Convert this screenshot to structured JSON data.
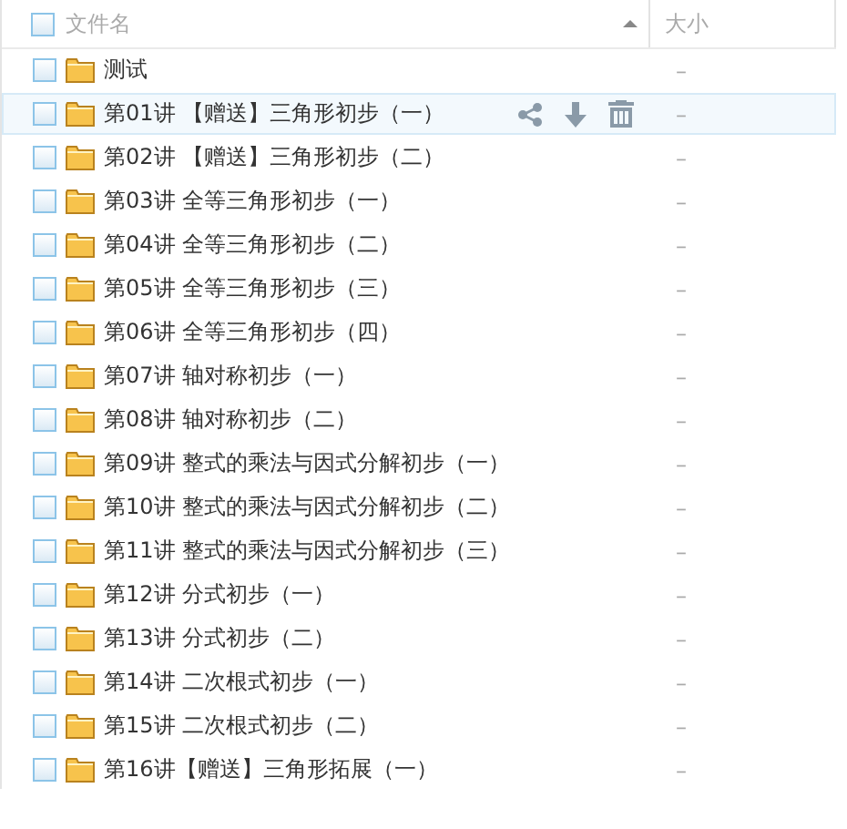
{
  "header": {
    "name_column": "文件名",
    "size_column": "大小",
    "sort_ascending": true,
    "checked": false
  },
  "rows": [
    {
      "name": "测试",
      "size": "–",
      "hovered": false,
      "checked": false
    },
    {
      "name": "第01讲 【赠送】三角形初步（一）",
      "size": "–",
      "hovered": true,
      "checked": false
    },
    {
      "name": "第02讲 【赠送】三角形初步（二）",
      "size": "–",
      "hovered": false,
      "checked": false
    },
    {
      "name": "第03讲 全等三角形初步（一）",
      "size": "–",
      "hovered": false,
      "checked": false
    },
    {
      "name": "第04讲 全等三角形初步（二）",
      "size": "–",
      "hovered": false,
      "checked": false
    },
    {
      "name": "第05讲 全等三角形初步（三）",
      "size": "–",
      "hovered": false,
      "checked": false
    },
    {
      "name": "第06讲 全等三角形初步（四）",
      "size": "–",
      "hovered": false,
      "checked": false
    },
    {
      "name": "第07讲 轴对称初步（一）",
      "size": "–",
      "hovered": false,
      "checked": false
    },
    {
      "name": "第08讲 轴对称初步（二）",
      "size": "–",
      "hovered": false,
      "checked": false
    },
    {
      "name": "第09讲 整式的乘法与因式分解初步（一）",
      "size": "–",
      "hovered": false,
      "checked": false
    },
    {
      "name": "第10讲 整式的乘法与因式分解初步（二）",
      "size": "–",
      "hovered": false,
      "checked": false
    },
    {
      "name": "第11讲 整式的乘法与因式分解初步（三）",
      "size": "–",
      "hovered": false,
      "checked": false
    },
    {
      "name": "第12讲 分式初步（一）",
      "size": "–",
      "hovered": false,
      "checked": false
    },
    {
      "name": "第13讲 分式初步（二）",
      "size": "–",
      "hovered": false,
      "checked": false
    },
    {
      "name": "第14讲 二次根式初步（一）",
      "size": "–",
      "hovered": false,
      "checked": false
    },
    {
      "name": "第15讲 二次根式初步（二）",
      "size": "–",
      "hovered": false,
      "checked": false
    },
    {
      "name": "第16讲【赠送】三角形拓展（一）",
      "size": "–",
      "hovered": false,
      "checked": false
    }
  ]
}
